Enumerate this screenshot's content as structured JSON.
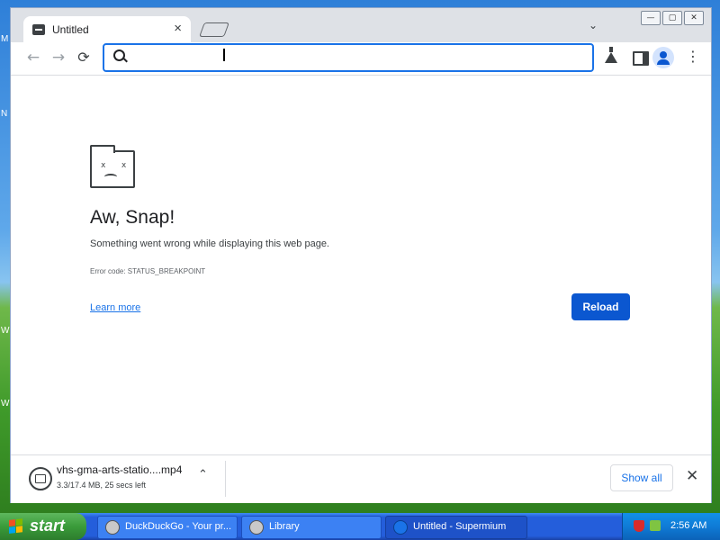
{
  "desktop": {
    "edge_labels": [
      "M",
      "N",
      "W",
      "W"
    ]
  },
  "browser": {
    "tab": {
      "title": "Untitled",
      "close": "×"
    },
    "tab_search": "⌄",
    "window_controls": {
      "minimize": "—",
      "maximize": "▢",
      "close": "✕"
    },
    "toolbar": {
      "back": "←",
      "forward": "→",
      "reload": "⟳",
      "omnibox_value": "",
      "omnibox_placeholder": "",
      "menu": "⋮"
    },
    "error_page": {
      "title": "Aw, Snap!",
      "description": "Something went wrong while displaying this web page.",
      "error_code": "Error code: STATUS_BREAKPOINT",
      "learn_more": "Learn more",
      "reload_button": "Reload",
      "face": "x x"
    },
    "download": {
      "file_name": "vhs-gma-arts-statio....mp4",
      "status": "3.3/17.4 MB, 25 secs left",
      "chevron": "⌃",
      "show_all": "Show all",
      "close": "✕"
    }
  },
  "taskbar": {
    "start_label": "start",
    "items": [
      {
        "label": "DuckDuckGo - Your pr..."
      },
      {
        "label": "Library"
      },
      {
        "label": "Untitled - Supermium"
      }
    ],
    "clock": "2:56 AM"
  },
  "colors": {
    "accent": "#1a73e8",
    "reload_button": "#0b57d0",
    "taskbar": "#245edb",
    "start_button": "#3a9b3a"
  }
}
